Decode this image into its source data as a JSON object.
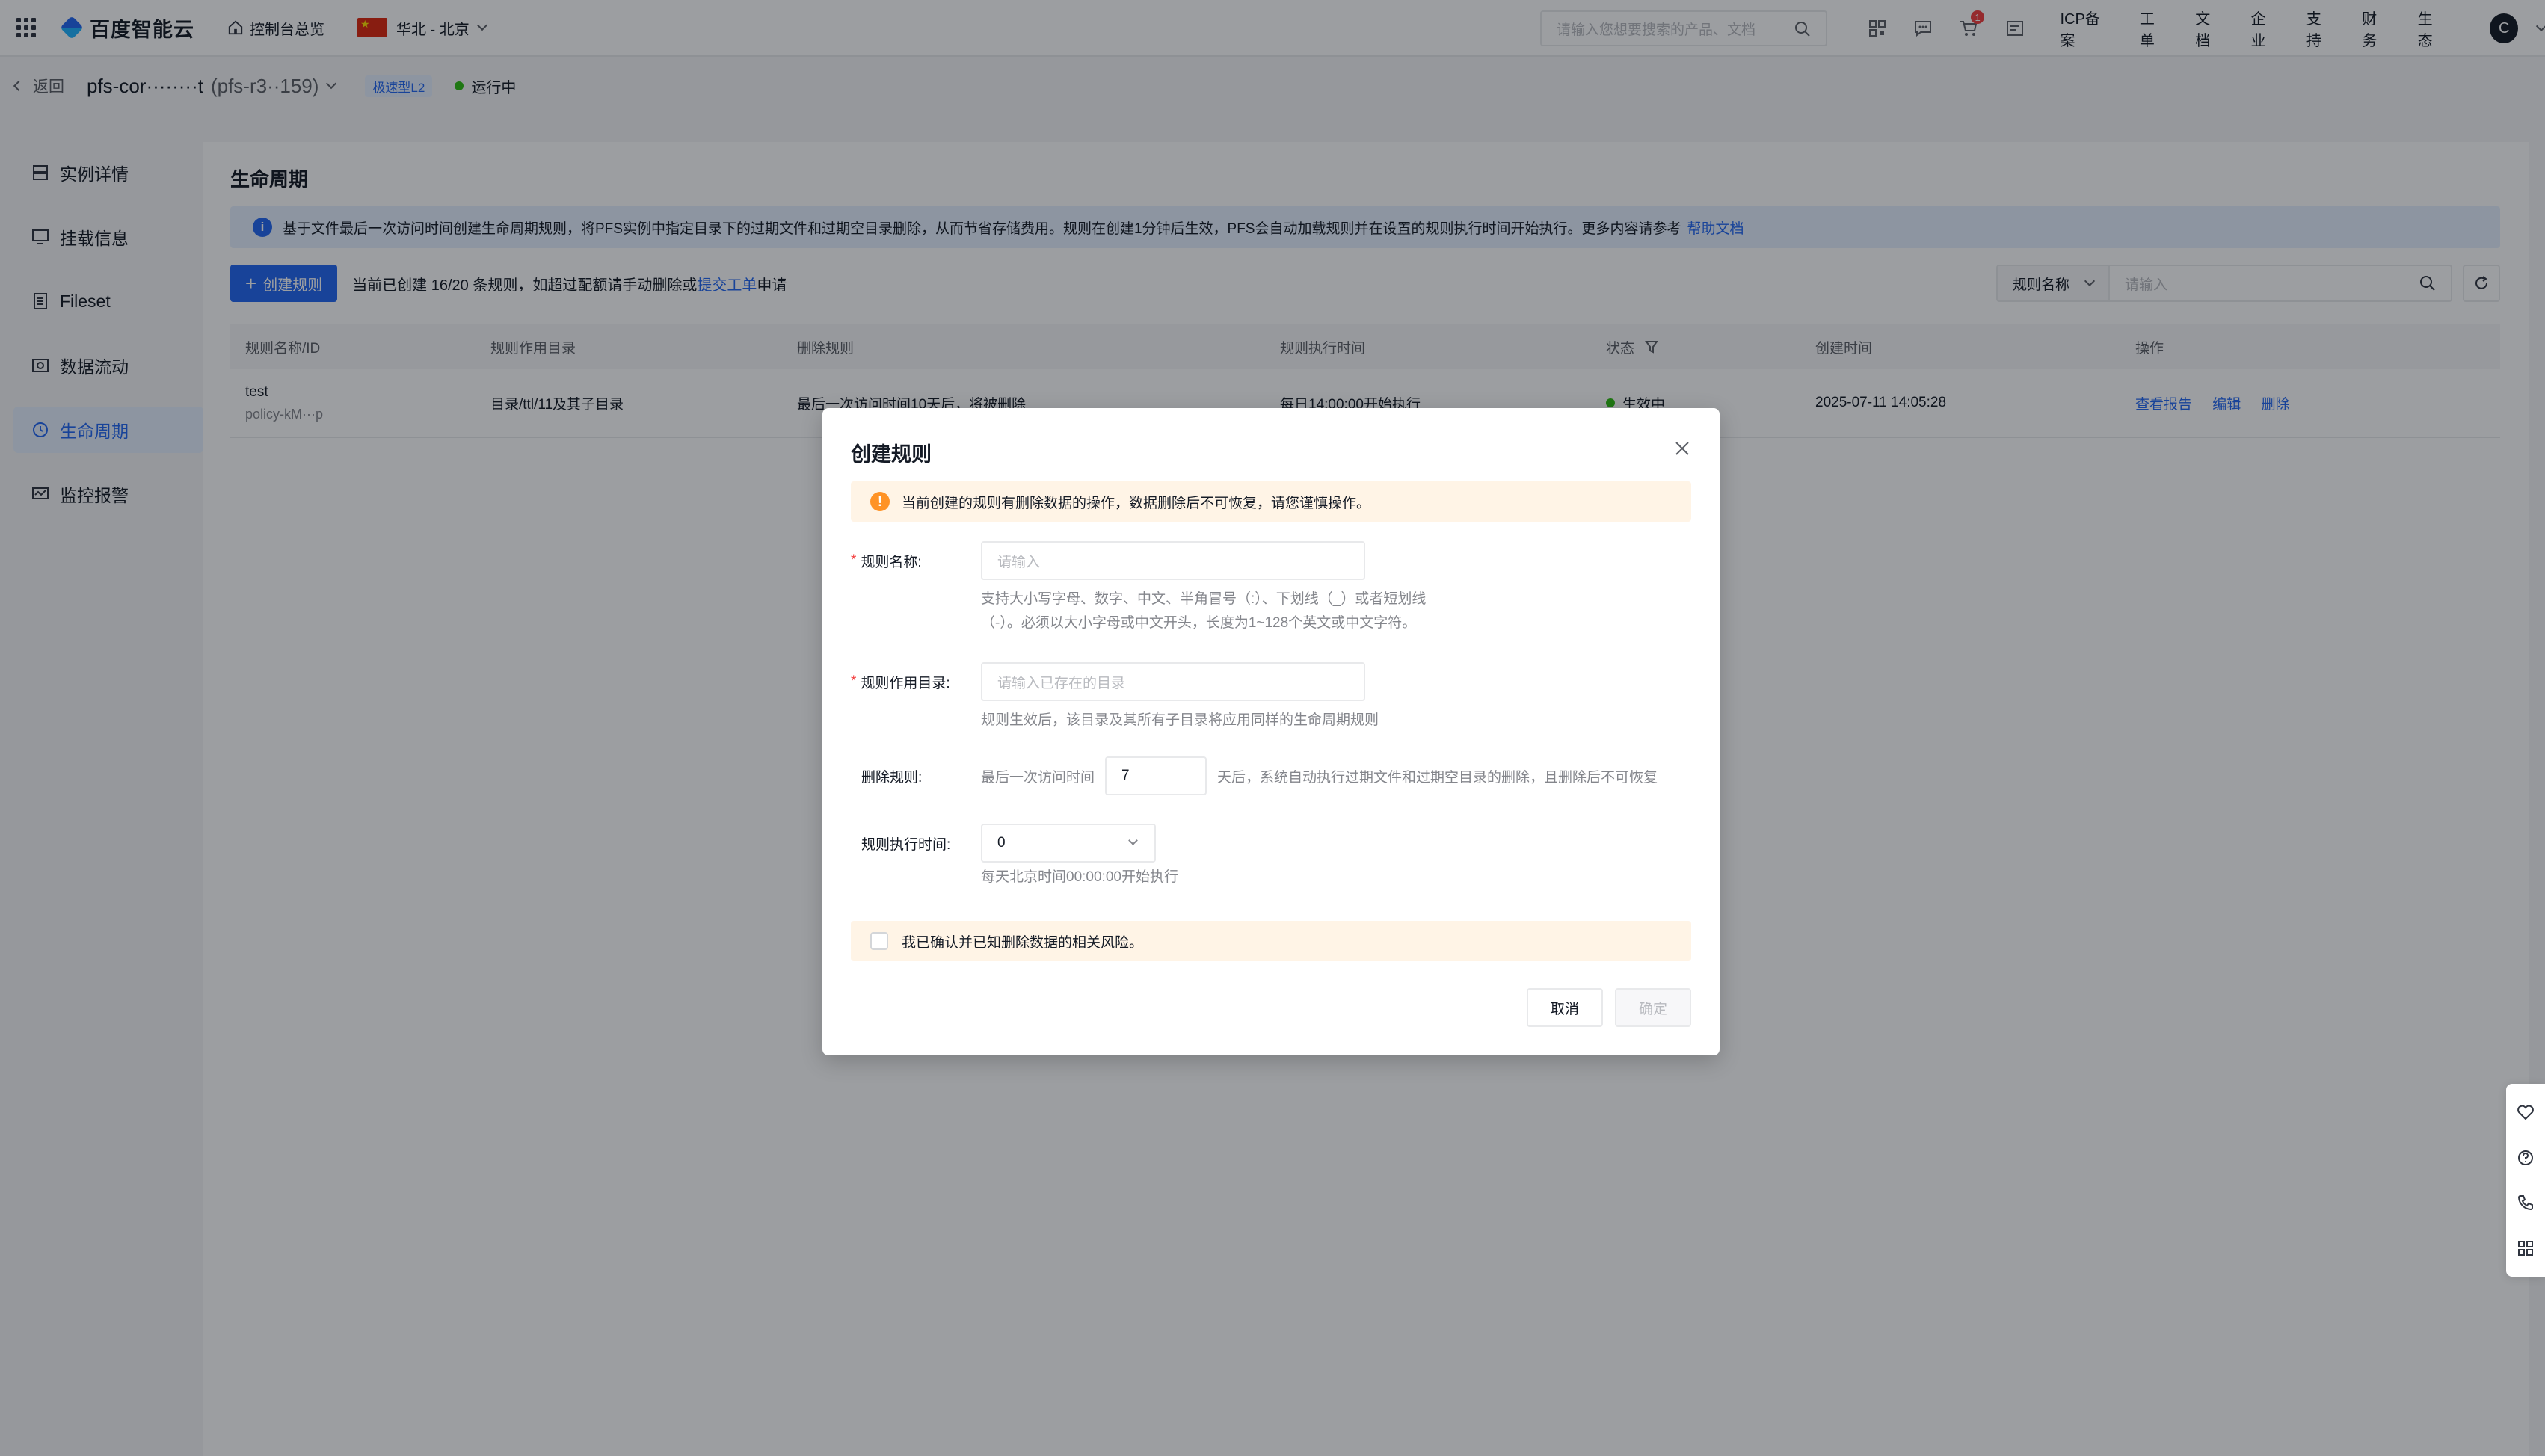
{
  "topbar": {
    "logo_text": "百度智能云",
    "console_link": "控制台总览",
    "region": "华北 - 北京",
    "search_placeholder": "请输入您想要搜索的产品、文档",
    "cart_badge": "1",
    "links": [
      "ICP备案",
      "工单",
      "文档",
      "企业",
      "支持",
      "财务",
      "生态"
    ],
    "avatar_letter": "C"
  },
  "subheader": {
    "back_label": "返回",
    "instance_name": "pfs-cor········t",
    "instance_id": "(pfs-r3··159)",
    "tag": "极速型L2",
    "status": "运行中"
  },
  "sidebar": {
    "items": [
      {
        "label": "实例详情"
      },
      {
        "label": "挂载信息"
      },
      {
        "label": "Fileset"
      },
      {
        "label": "数据流动"
      },
      {
        "label": "生命周期"
      },
      {
        "label": "监控报警"
      }
    ]
  },
  "main": {
    "title": "生命周期",
    "info_text": "基于文件最后一次访问时间创建生命周期规则，将PFS实例中指定目录下的过期文件和过期空目录删除，从而节省存储费用。规则在创建1分钟后生效，PFS会自动加载规则并在设置的规则执行时间开始执行。更多内容请参考",
    "info_link": "帮助文档",
    "create_button": "创建规则",
    "quota_text": "当前已创建 16/20 条规则，如超过配额请手动删除或",
    "quota_link": "提交工单",
    "quota_suffix": "申请",
    "filter_select": "规则名称",
    "filter_placeholder": "请输入"
  },
  "table": {
    "headers": [
      "规则名称/ID",
      "规则作用目录",
      "删除规则",
      "规则执行时间",
      "状态",
      "创建时间",
      "操作"
    ],
    "rows": [
      {
        "name": "test",
        "id": "policy-kM···p",
        "directory": "目录/ttl/11及其子目录",
        "rule": "最后一次访问时间10天后，将被删除",
        "exec_time": "每日14:00:00开始执行",
        "status": "生效中",
        "created": "2025-07-11 14:05:28",
        "actions": [
          "查看报告",
          "编辑",
          "删除"
        ]
      }
    ]
  },
  "dialog": {
    "title": "创建规则",
    "warning": "当前创建的规则有删除数据的操作，数据删除后不可恢复，请您谨慎操作。",
    "name_label": "规则名称:",
    "name_placeholder": "请输入",
    "name_help_1": "支持大小写字母、数字、中文、半角冒号（:）、下划线（_）或者短划线",
    "name_help_2": "（-）。必须以大小字母或中文开头，长度为1~128个英文或中文字符。",
    "dir_label": "规则作用目录:",
    "dir_placeholder": "请输入已存在的目录",
    "dir_help": "规则生效后，该目录及其所有子目录将应用同样的生命周期规则",
    "delete_label": "删除规则:",
    "delete_prefix": "最后一次访问时间",
    "delete_days": "7",
    "delete_suffix": "天后，系统自动执行过期文件和过期空目录的删除，且删除后不可恢复",
    "exec_label": "规则执行时间:",
    "exec_value": "0",
    "exec_help": "每天北京时间00:00:00开始执行",
    "confirm_text": "我已确认并已知删除数据的相关风险。",
    "cancel_button": "取消",
    "ok_button": "确定"
  }
}
